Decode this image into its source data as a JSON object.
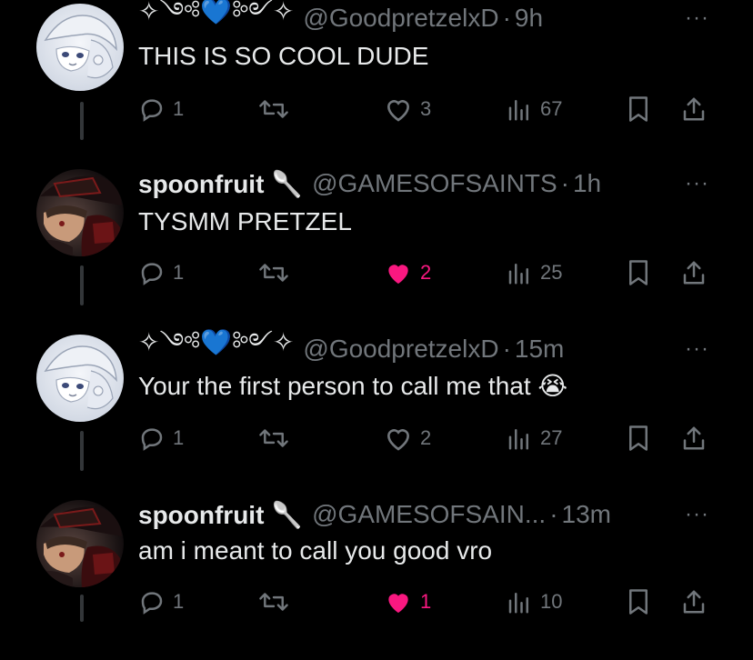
{
  "tweets": [
    {
      "display_name": "✧༺💙༻✧",
      "handle": "@GoodpretzelxD",
      "separator": "·",
      "time": "9h",
      "text": "THIS IS SO COOL DUDE",
      "replies": "1",
      "likes": "3",
      "liked": false,
      "views": "67",
      "avatar": "white-anime-avatar"
    },
    {
      "display_name": "spoonfruit 🥄",
      "handle": "@GAMESOFSAINTS",
      "separator": "·",
      "time": "1h",
      "text": "TYSMM PRETZEL",
      "replies": "1",
      "likes": "2",
      "liked": true,
      "views": "25",
      "avatar": "dark-red-anime-avatar"
    },
    {
      "display_name": "✧༺💙༻✧",
      "handle": "@GoodpretzelxD",
      "separator": "·",
      "time": "15m",
      "text": "Your the first person to call me that 😭",
      "replies": "1",
      "likes": "2",
      "liked": false,
      "views": "27",
      "avatar": "white-anime-avatar"
    },
    {
      "display_name": "spoonfruit 🥄",
      "handle": "@GAMESOFSAIN...",
      "separator": "·",
      "time": "13m",
      "text": "am i meant to call you good vro",
      "replies": "1",
      "likes": "1",
      "liked": true,
      "views": "10",
      "avatar": "dark-red-anime-avatar"
    }
  ],
  "more_glyph": "···",
  "colors": {
    "background": "#000000",
    "text": "#e7e9ea",
    "muted": "#71767b",
    "like_active": "#f91880",
    "thread_line": "#333639"
  }
}
